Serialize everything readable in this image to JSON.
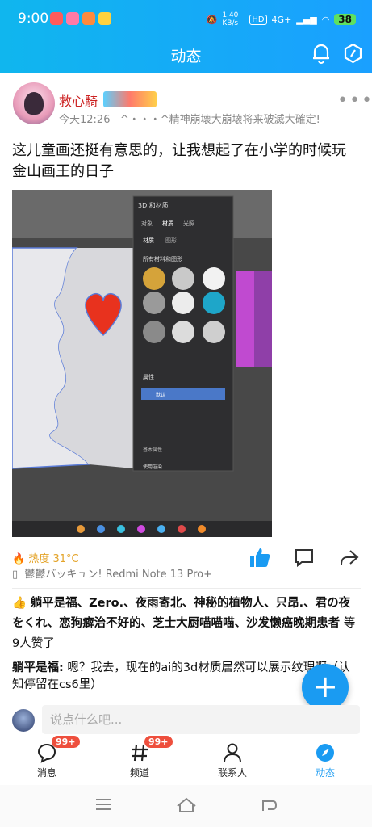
{
  "status_bar": {
    "time": "9:00",
    "net_speed": "1.40 KB/s",
    "network": "4G+",
    "battery": "38"
  },
  "header": {
    "title": "动态"
  },
  "post": {
    "username": "救心騎",
    "time": "今天12:26",
    "signature": "^・・・^精神崩壊大崩壊将来破滅大確定!",
    "content": "这儿童画还挺有意思的，让我想起了在小学的时候玩金山画王的日子",
    "image": {
      "panel_title": "3D 和材质",
      "panel_tabs": [
        "对象",
        "材质",
        "光照"
      ],
      "sub_tabs": [
        "材质",
        "图形"
      ],
      "section_all": "所有材料和图形",
      "section_props": "属性",
      "property_item": "默认",
      "basic_props": "基本属性",
      "render_button": "使用渲染"
    },
    "heat": "热度 31°C",
    "device": "鬱鬱バッキュン! Redmi Note 13 Pro+",
    "likes_names": "躺平是福、Zero.、夜雨寄北、神秘的植物人、只昂.、君の夜をくれ、恋狗癖治不好的、芝士大厨喵喵喵、沙发懒癌晚期患者",
    "likes_suffix": " 等9人赞了",
    "reply_user": "躺平是福:",
    "reply_text": " 嗯？我去，现在的ai的3d材质居然可以展示纹理啊（认知停留在cs6里）"
  },
  "comment_input": {
    "placeholder": "说点什么吧..."
  },
  "fab": {
    "label": "+"
  },
  "tabs": [
    {
      "label": "消息",
      "badge": "99+",
      "icon": "message-icon"
    },
    {
      "label": "频道",
      "badge": "99+",
      "icon": "hash-icon"
    },
    {
      "label": "联系人",
      "badge": "",
      "icon": "contacts-icon"
    },
    {
      "label": "动态",
      "badge": "",
      "icon": "feed-icon",
      "active": true
    }
  ],
  "colors": {
    "accent": "#1a9bf2",
    "header_start": "#10b6ee",
    "username": "#cc2222",
    "heat": "#e4a42a",
    "badge": "#ee4f3d"
  }
}
